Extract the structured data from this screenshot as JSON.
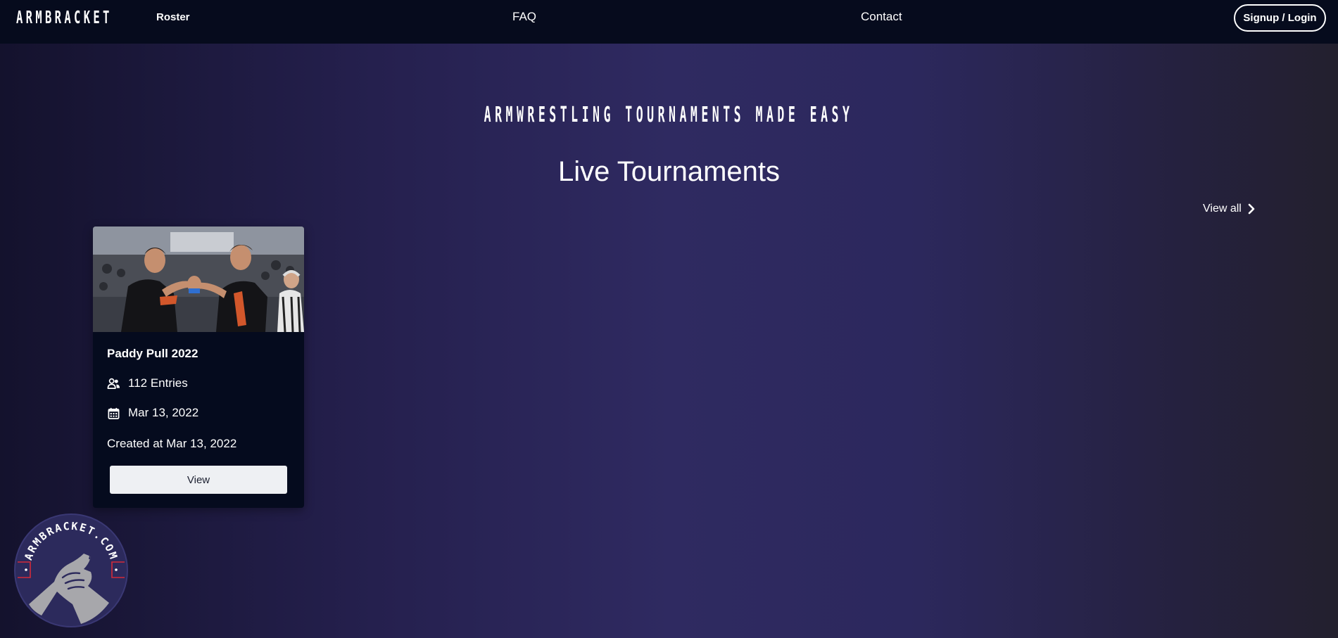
{
  "navbar": {
    "brand": "ARMBRACKET",
    "links": {
      "roster": "Roster",
      "faq": "FAQ",
      "contact": "Contact"
    },
    "login_label": "Signup / Login"
  },
  "hero": {
    "tagline": "ARMWRESTLING TOURNAMENTS MADE EASY",
    "section_title": "Live Tournaments",
    "view_all": "View all"
  },
  "tournaments": [
    {
      "name": "Paddy Pull 2022",
      "entries": "112 Entries",
      "date": "Mar 13, 2022",
      "created": "Created at Mar 13, 2022",
      "view_label": "View",
      "image_icon": "armwrestling-photo"
    }
  ],
  "badge": {
    "text": "ARMBRACKET.COM",
    "icon": "armwrestling-hands-logo"
  },
  "colors": {
    "navbar_bg": "#060b1d",
    "card_bg": "#050b1e",
    "button_bg": "#eef0f3",
    "accent_red": "#d42a3a",
    "badge_bg": "#2c2a5c"
  }
}
